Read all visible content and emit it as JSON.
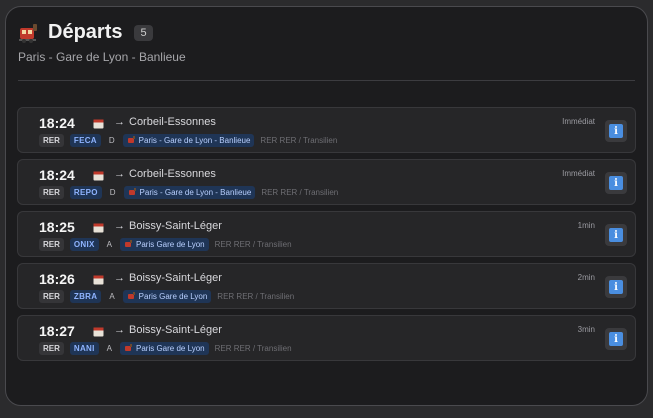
{
  "header": {
    "title": "Départs",
    "count": "5",
    "subtitle": "Paris - Gare de Lyon - Banlieue"
  },
  "departures": [
    {
      "time": "18:24",
      "destination": "Corbeil-Essonnes",
      "line": "RER",
      "code": "FECA",
      "quay": "D",
      "station": "Paris - Gare de Lyon - Banlieue",
      "mode": "RER RER / Transilien",
      "status": "Immédiat"
    },
    {
      "time": "18:24",
      "destination": "Corbeil-Essonnes",
      "line": "RER",
      "code": "REPO",
      "quay": "D",
      "station": "Paris - Gare de Lyon - Banlieue",
      "mode": "RER RER / Transilien",
      "status": "Immédiat"
    },
    {
      "time": "18:25",
      "destination": "Boissy-Saint-Léger",
      "line": "RER",
      "code": "ONIX",
      "quay": "A",
      "station": "Paris Gare de Lyon",
      "mode": "RER RER / Transilien",
      "status": "1min"
    },
    {
      "time": "18:26",
      "destination": "Boissy-Saint-Léger",
      "line": "RER",
      "code": "ZBRA",
      "quay": "A",
      "station": "Paris Gare de Lyon",
      "mode": "RER RER / Transilien",
      "status": "2min"
    },
    {
      "time": "18:27",
      "destination": "Boissy-Saint-Léger",
      "line": "RER",
      "code": "NANI",
      "quay": "A",
      "station": "Paris Gare de Lyon",
      "mode": "RER RER / Transilien",
      "status": "3min"
    }
  ],
  "icons": {
    "train": "train-icon",
    "calendar": "calendar-icon",
    "info": "info-icon"
  },
  "colors": {
    "accent": "#4a8ee0",
    "badge_blue_bg": "#1f3556",
    "badge_blue_text": "#8fb4ff"
  }
}
